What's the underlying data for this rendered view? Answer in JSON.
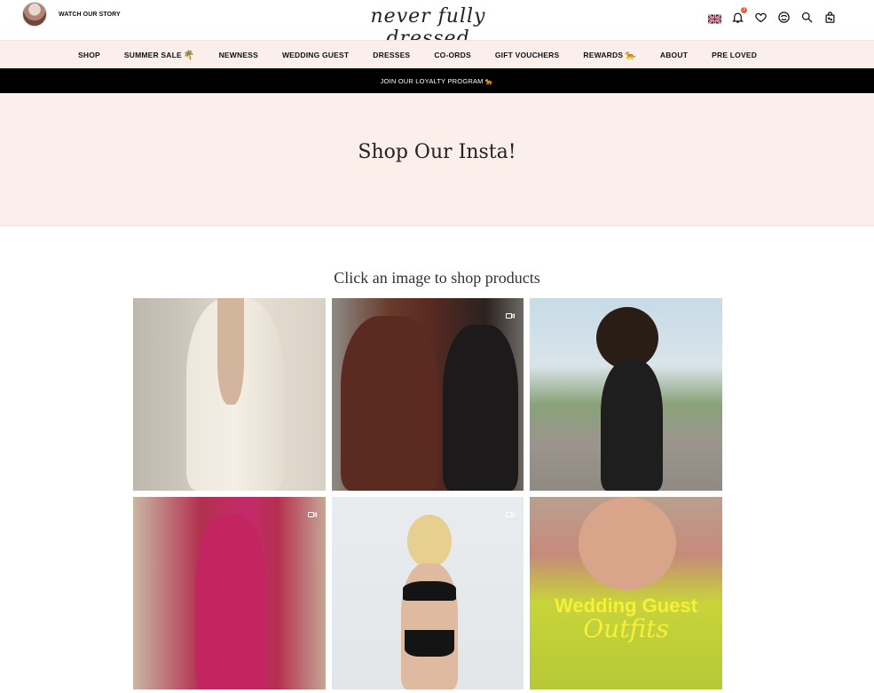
{
  "header": {
    "story_label": "WATCH OUR STORY",
    "logo_text": "never fully dressed",
    "notification_count": "3",
    "icons": [
      "uk-flag-icon",
      "bell-icon",
      "heart-icon",
      "rewards-icon",
      "search-icon",
      "bag-icon"
    ]
  },
  "nav": {
    "items": [
      {
        "label": "SHOP",
        "emoji": ""
      },
      {
        "label": "SUMMER SALE",
        "emoji": "🌴"
      },
      {
        "label": "NEWNESS",
        "emoji": ""
      },
      {
        "label": "WEDDING GUEST",
        "emoji": ""
      },
      {
        "label": "DRESSES",
        "emoji": ""
      },
      {
        "label": "CO-ORDS",
        "emoji": ""
      },
      {
        "label": "GIFT VOUCHERS",
        "emoji": ""
      },
      {
        "label": "REWARDS",
        "emoji": "🐆"
      },
      {
        "label": "ABOUT",
        "emoji": ""
      },
      {
        "label": "PRE LOVED",
        "emoji": ""
      }
    ]
  },
  "promo": {
    "text": "JOIN OUR LOYALTY PROGRAM 🐆"
  },
  "hero": {
    "title": "Shop Our Insta!"
  },
  "gallery": {
    "subtitle": "Click an image to shop products",
    "tiles": [
      {
        "has_video": false,
        "caption_line1": "",
        "caption_line2": ""
      },
      {
        "has_video": true,
        "caption_line1": "",
        "caption_line2": ""
      },
      {
        "has_video": false,
        "caption_line1": "",
        "caption_line2": ""
      },
      {
        "has_video": true,
        "caption_line1": "",
        "caption_line2": ""
      },
      {
        "has_video": true,
        "caption_line1": "",
        "caption_line2": ""
      },
      {
        "has_video": false,
        "caption_line1": "Wedding Guest",
        "caption_line2": "Outfits"
      }
    ]
  },
  "colors": {
    "nav_bg": "#fbefec",
    "promo_bg": "#000000",
    "hero_bg": "#fbefec",
    "badge": "#e55a3a"
  }
}
